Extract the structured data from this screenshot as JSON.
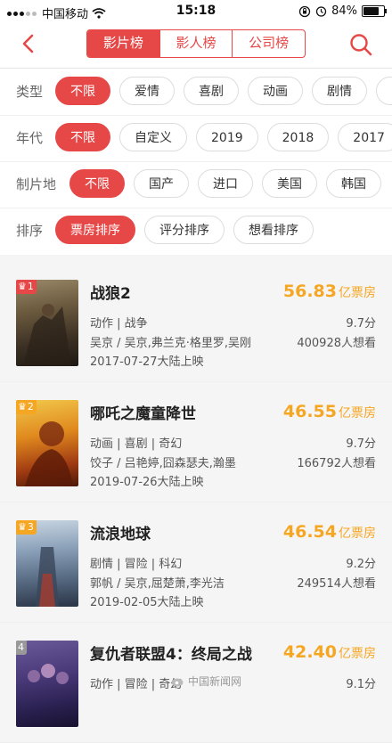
{
  "status_bar": {
    "carrier": "中国移动",
    "time": "15:18",
    "battery": "84%",
    "battery_level": 0.84
  },
  "nav": {
    "tabs": [
      "影片榜",
      "影人榜",
      "公司榜"
    ],
    "active_tab": 0
  },
  "filters": [
    {
      "label": "类型",
      "options": [
        "不限",
        "爱情",
        "喜剧",
        "动画",
        "剧情",
        ""
      ]
    },
    {
      "label": "年代",
      "options": [
        "不限",
        "自定义",
        "2019",
        "2018",
        "2017"
      ]
    },
    {
      "label": "制片地",
      "options": [
        "不限",
        "国产",
        "进口",
        "美国",
        "韩国"
      ]
    },
    {
      "label": "排序",
      "options": [
        "票房排序",
        "评分排序",
        "想看排序"
      ]
    }
  ],
  "movies": [
    {
      "rank": "1",
      "title": "战狼2",
      "box_office": "56.83",
      "unit": "亿票房",
      "genres": "动作 | 战争",
      "rating": "9.7分",
      "cast": "吴京 / 吴京,弗兰克·格里罗,吴刚",
      "wants": "400928人想看",
      "release": "2017-07-27大陆上映"
    },
    {
      "rank": "2",
      "title": "哪吒之魔童降世",
      "box_office": "46.55",
      "unit": "亿票房",
      "genres": "动画 | 喜剧 | 奇幻",
      "rating": "9.7分",
      "cast": "饺子 / 吕艳婷,囧森瑟夫,瀚墨",
      "wants": "166792人想看",
      "release": "2019-07-26大陆上映"
    },
    {
      "rank": "3",
      "title": "流浪地球",
      "box_office": "46.54",
      "unit": "亿票房",
      "genres": "剧情 | 冒险 | 科幻",
      "rating": "9.2分",
      "cast": "郭帆 / 吴京,屈楚萧,李光洁",
      "wants": "249514人想看",
      "release": "2019-02-05大陆上映"
    },
    {
      "rank": "4",
      "title": "复仇者联盟4：终局之战",
      "box_office": "42.40",
      "unit": "亿票房",
      "genres": "动作 | 冒险 | 奇幻",
      "rating": "9.1分",
      "cast": "",
      "wants": "",
      "release": ""
    }
  ],
  "watermark": "中国新闻网"
}
